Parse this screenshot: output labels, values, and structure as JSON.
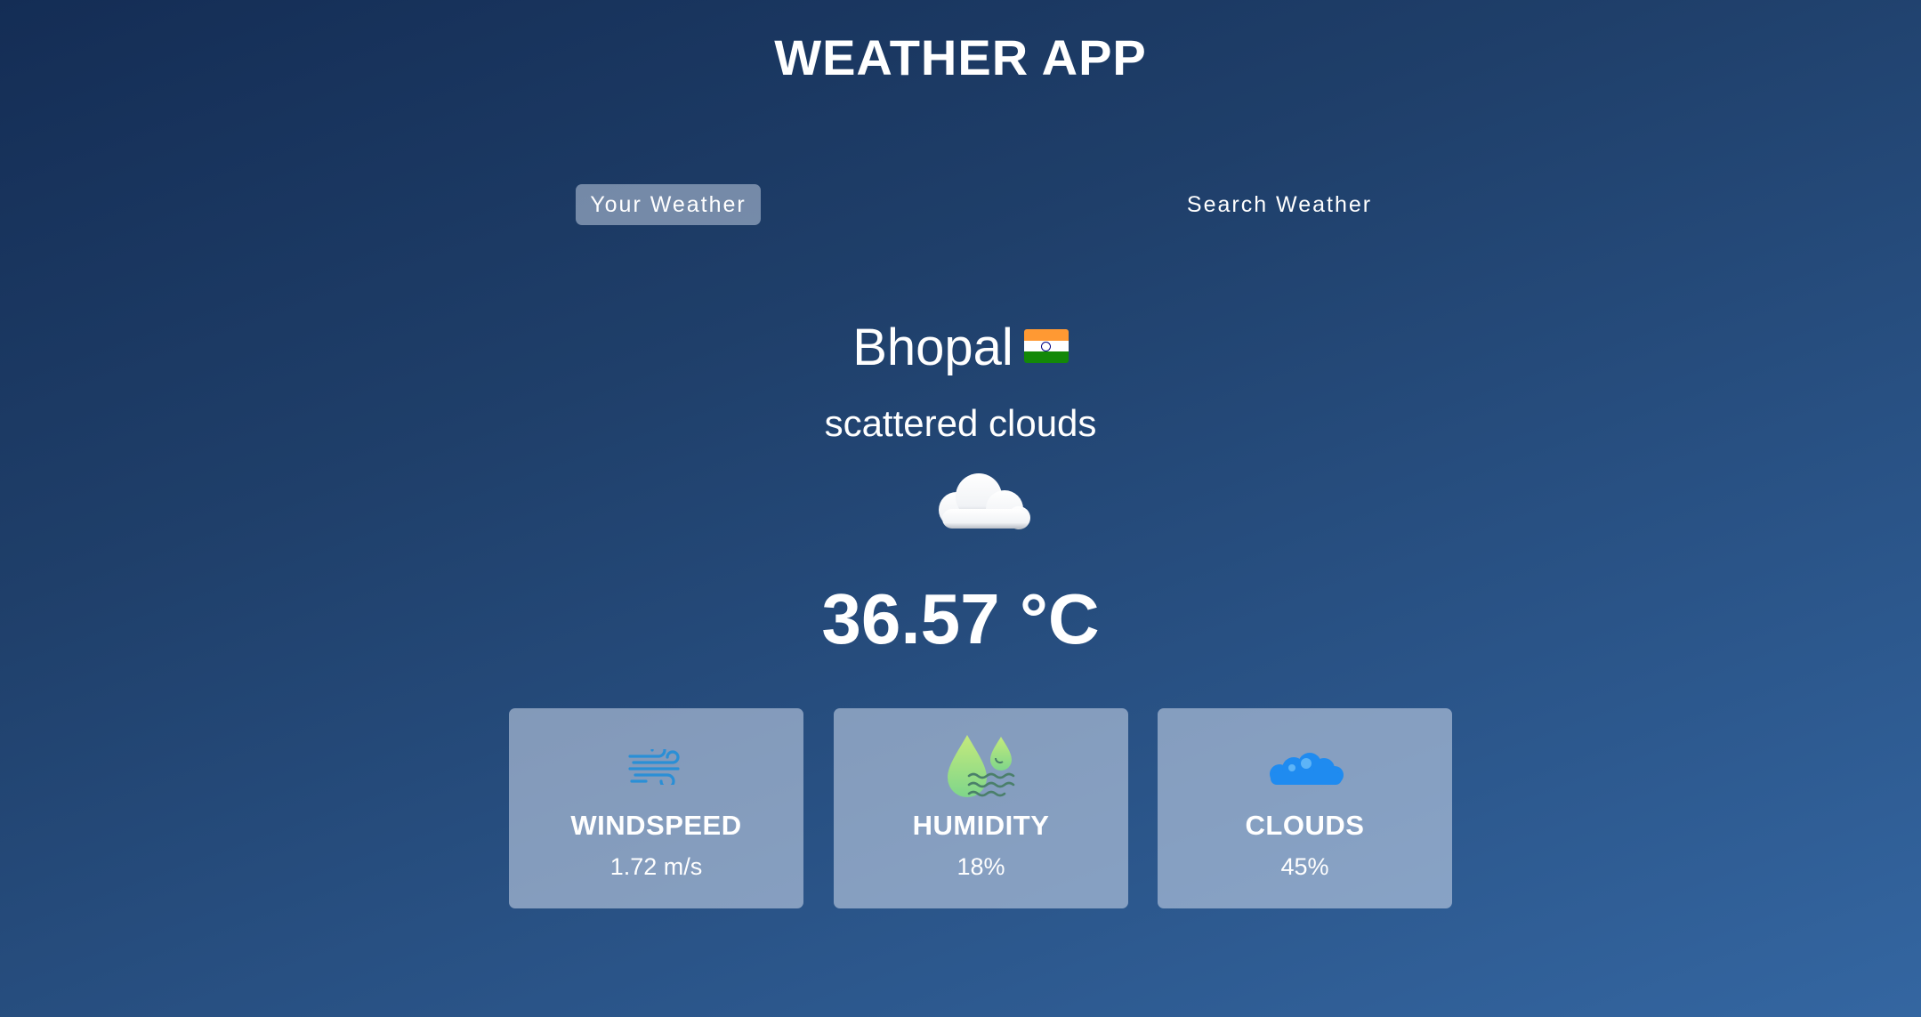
{
  "app": {
    "title": "WEATHER APP"
  },
  "tabs": [
    {
      "label": "Your Weather",
      "active": true
    },
    {
      "label": "Search Weather",
      "active": false
    }
  ],
  "weather": {
    "city": "Bhopal",
    "country_flag": "india-flag-icon",
    "description": "scattered clouds",
    "condition_icon": "cloud-icon",
    "temperature": "36.57 °C"
  },
  "stats": [
    {
      "label": "WINDSPEED",
      "value": "1.72 m/s",
      "icon": "wind-icon"
    },
    {
      "label": "HUMIDITY",
      "value": "18%",
      "icon": "humidity-icon"
    },
    {
      "label": "CLOUDS",
      "value": "45%",
      "icon": "clouds-icon"
    }
  ],
  "colors": {
    "background_start": "#142d55",
    "background_end": "#3466a1",
    "card_background": "#8aa0c2",
    "wind_icon": "#2a8fd6",
    "humidity_icon": "#a6e07a",
    "clouds_icon": "#1f8bf0"
  }
}
